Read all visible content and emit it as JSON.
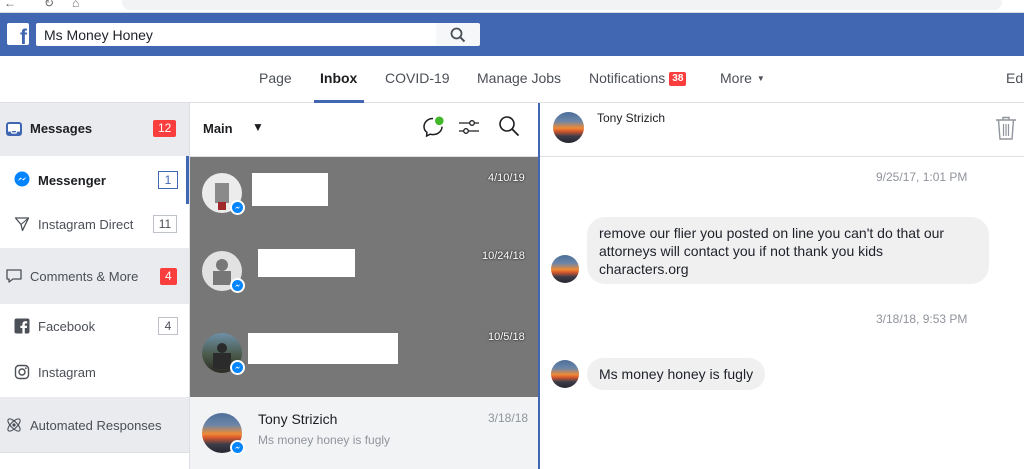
{
  "header": {
    "search_value": "Ms Money Honey"
  },
  "nav": {
    "tabs": [
      {
        "label": "Page"
      },
      {
        "label": "Inbox"
      },
      {
        "label": "COVID-19"
      },
      {
        "label": "Manage Jobs"
      },
      {
        "label": "Notifications",
        "badge": "38"
      },
      {
        "label": "More"
      },
      {
        "label": "Ed"
      }
    ]
  },
  "sidebar": {
    "items": [
      {
        "label": "Messages",
        "count": "12"
      },
      {
        "label": "Messenger",
        "count": "1"
      },
      {
        "label": "Instagram Direct",
        "count": "11"
      },
      {
        "label": "Comments & More",
        "count": "4"
      },
      {
        "label": "Facebook",
        "count": "4"
      },
      {
        "label": "Instagram"
      },
      {
        "label": "Automated Responses"
      }
    ]
  },
  "conversation_list": {
    "filter_label": "Main",
    "conversations": [
      {
        "date": "4/10/19"
      },
      {
        "date": "10/24/18"
      },
      {
        "date": "10/5/18"
      },
      {
        "name": "Tony Strizich",
        "preview": "Ms money honey is fugly",
        "date": "3/18/18"
      }
    ]
  },
  "chat": {
    "contact_name": "Tony Strizich",
    "messages": [
      {
        "timestamp": "9/25/17, 1:01 PM",
        "line1": "remove our flier you posted on line you can't do that  our",
        "line2": "attorneys will contact you if not  thank you kids",
        "line3": "characters.org"
      },
      {
        "timestamp": "3/18/18, 9:53 PM",
        "text": "Ms money honey is fugly"
      }
    ]
  },
  "colors": {
    "brand_blue": "#4267b2",
    "badge_red": "#fa3e3e",
    "messenger_blue": "#0084ff",
    "online_green": "#42b72a"
  }
}
